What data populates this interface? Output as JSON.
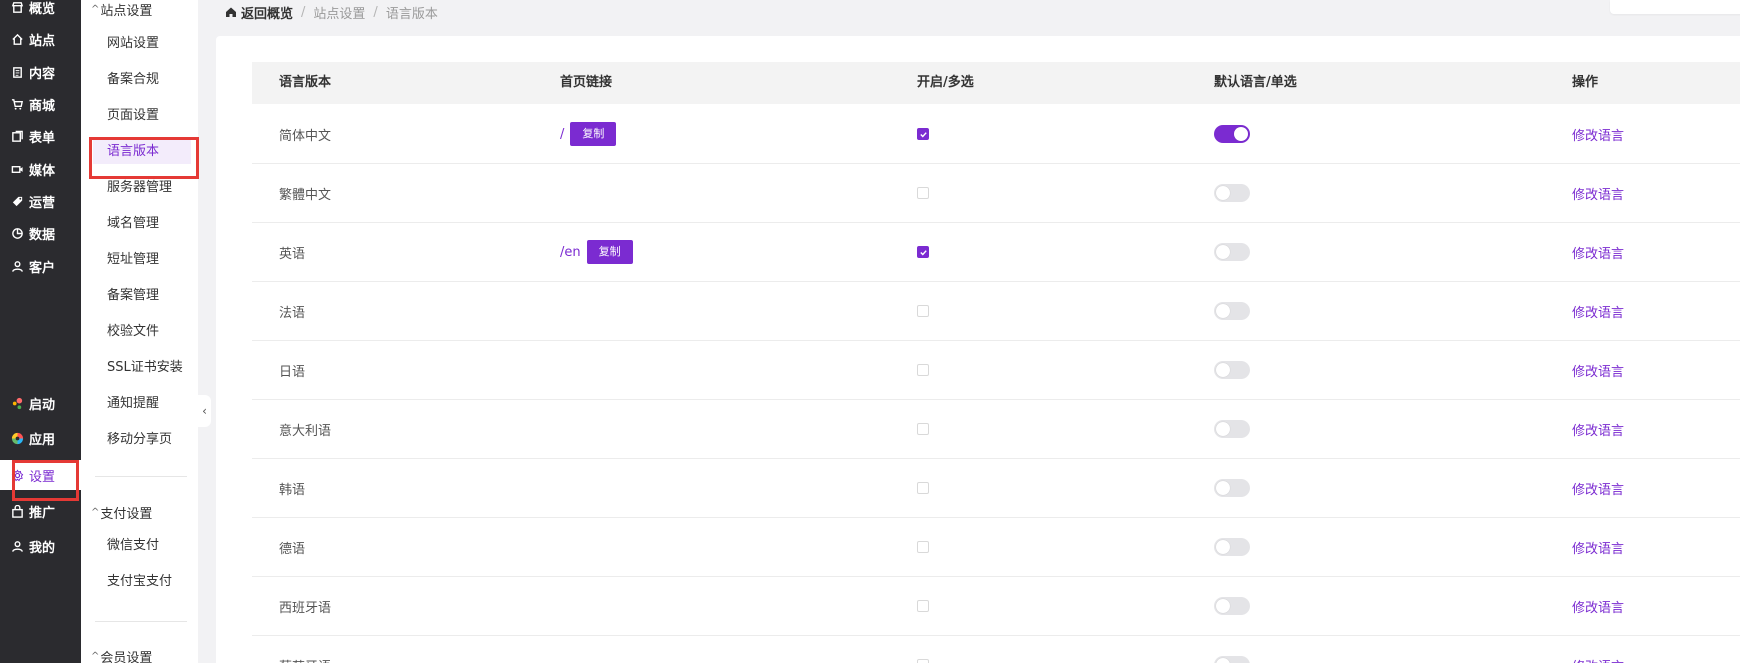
{
  "nav": {
    "items": [
      {
        "label": "概览",
        "icon": "store-icon"
      },
      {
        "label": "站点",
        "icon": "home-icon"
      },
      {
        "label": "内容",
        "icon": "document-icon"
      },
      {
        "label": "商城",
        "icon": "cart-icon"
      },
      {
        "label": "表单",
        "icon": "form-icon"
      },
      {
        "label": "媒体",
        "icon": "video-icon"
      },
      {
        "label": "运营",
        "icon": "tag-icon"
      },
      {
        "label": "数据",
        "icon": "chart-pie-icon"
      },
      {
        "label": "客户",
        "icon": "user-icon"
      },
      {
        "label": "启动",
        "icon": "launch-icon"
      },
      {
        "label": "应用",
        "icon": "apps-icon"
      },
      {
        "label": "设置",
        "icon": "gear-icon"
      },
      {
        "label": "推广",
        "icon": "bag-icon"
      },
      {
        "label": "我的",
        "icon": "user-icon"
      }
    ]
  },
  "submenu": {
    "group1": "站点设置",
    "group1_items": [
      "网站设置",
      "备案合规",
      "页面设置",
      "语言版本",
      "服务器管理",
      "域名管理",
      "短址管理",
      "备案管理",
      "校验文件",
      "SSL证书安装",
      "通知提醒",
      "移动分享页"
    ],
    "group2": "支付设置",
    "group2_items": [
      "微信支付",
      "支付宝支付"
    ],
    "group3": "会员设置"
  },
  "breadcrumb": {
    "home": "返回概览",
    "level1": "站点设置",
    "level2": "语言版本"
  },
  "table": {
    "headers": [
      "语言版本",
      "首页链接",
      "开启/多选",
      "默认语言/单选",
      "操作"
    ],
    "copy_label": "复制",
    "action_label": "修改语言",
    "rows": [
      {
        "name": "简体中文",
        "link": "/",
        "enabled": true,
        "default": true
      },
      {
        "name": "繁體中文",
        "link": "",
        "enabled": false,
        "default": false
      },
      {
        "name": "英语",
        "link": "/en",
        "enabled": true,
        "default": false
      },
      {
        "name": "法语",
        "link": "",
        "enabled": false,
        "default": false
      },
      {
        "name": "日语",
        "link": "",
        "enabled": false,
        "default": false
      },
      {
        "name": "意大利语",
        "link": "",
        "enabled": false,
        "default": false
      },
      {
        "name": "韩语",
        "link": "",
        "enabled": false,
        "default": false
      },
      {
        "name": "德语",
        "link": "",
        "enabled": false,
        "default": false
      },
      {
        "name": "西班牙语",
        "link": "",
        "enabled": false,
        "default": false
      },
      {
        "name": "葡萄牙语",
        "link": "",
        "enabled": false,
        "default": false
      }
    ]
  },
  "colors": {
    "accent": "#7b2bd1",
    "nav_bg": "#2b2b2f",
    "highlight_box": "#e53935"
  }
}
